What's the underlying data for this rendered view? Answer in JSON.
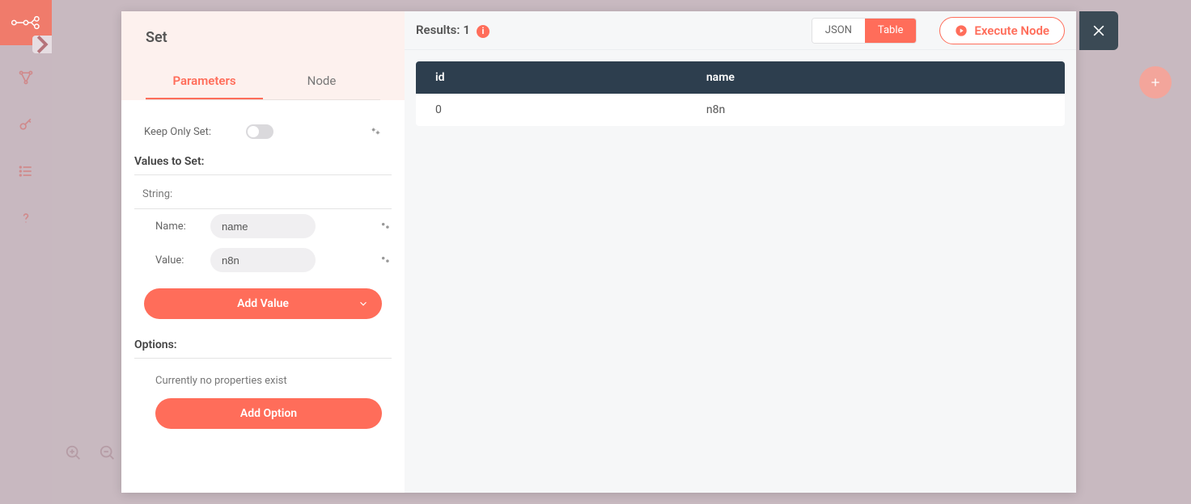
{
  "panel": {
    "title": "Set",
    "tabs": {
      "parameters": "Parameters",
      "node": "Node"
    },
    "keep_only_set_label": "Keep Only Set:",
    "values_to_set_label": "Values to Set:",
    "string_label": "String:",
    "name_label": "Name:",
    "name_value": "name",
    "value_label": "Value:",
    "value_value": "n8n",
    "add_value_label": "Add Value",
    "options_label": "Options:",
    "no_properties_text": "Currently no properties exist",
    "add_option_label": "Add Option"
  },
  "results": {
    "label_prefix": "Results:",
    "count": "1",
    "seg_json": "JSON",
    "seg_table": "Table",
    "execute_label": "Execute Node"
  },
  "table": {
    "columns": {
      "id": "id",
      "name": "name"
    },
    "row": {
      "id": "0",
      "name": "n8n"
    }
  }
}
